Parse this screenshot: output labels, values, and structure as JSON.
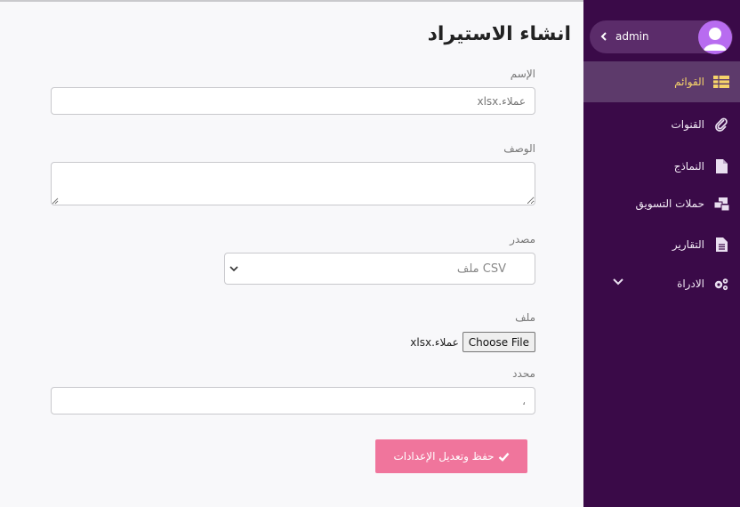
{
  "page": {
    "title": "انشاء الاستيراد"
  },
  "form": {
    "name_label": "الإسم",
    "name_value": "عملاء.xlsx",
    "description_label": "الوصف",
    "description_value": "",
    "source_label": "مصدر",
    "source_selected": "CSV ملف",
    "file_label": "ملف",
    "file_button": "Choose File",
    "file_name": "عملاء.xlsx",
    "delimiter_label": "محدد",
    "delimiter_value": "،",
    "submit_label": "حفظ وتعديل الإعدادات"
  },
  "sidebar": {
    "user": {
      "name": "admin"
    },
    "items": [
      {
        "label": "القوائم",
        "icon": "table-icon",
        "active": true
      },
      {
        "label": "القنوات",
        "icon": "paperclip-icon",
        "active": false
      },
      {
        "label": "النماذج",
        "icon": "file-icon",
        "active": false
      },
      {
        "label": "حملات التسويق",
        "icon": "mail-bulk-icon",
        "active": false
      },
      {
        "label": "التقارير",
        "icon": "file-text-icon",
        "active": false
      },
      {
        "label": "الادراة",
        "icon": "cogs-icon",
        "active": false
      }
    ]
  },
  "colors": {
    "sidebar_bg": "#3a0a48",
    "sidebar_active": "#5d3a6b",
    "active_text": "#f6d36a",
    "submit_bg": "#f0759c",
    "avatar_bg": "#b86cf0"
  }
}
